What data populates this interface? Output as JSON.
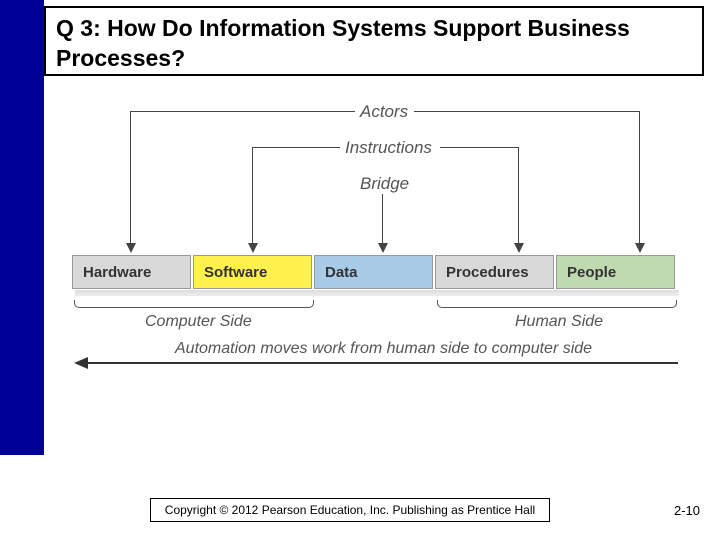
{
  "title": "Q 3: How Do Information Systems Support Business Processes?",
  "top_labels": {
    "actors": "Actors",
    "instructions": "Instructions",
    "bridge": "Bridge"
  },
  "components": [
    {
      "label": "Hardware",
      "bg": "#d9d9d9"
    },
    {
      "label": "Software",
      "bg": "#fff04d"
    },
    {
      "label": "Data",
      "bg": "#a8cce8"
    },
    {
      "label": "Procedures",
      "bg": "#d9d9d9"
    },
    {
      "label": "People",
      "bg": "#bfd9b0"
    }
  ],
  "sides": {
    "computer": "Computer Side",
    "human": "Human Side"
  },
  "automation_caption": "Automation moves work from human side to computer side",
  "copyright": "Copyright © 2012 Pearson Education, Inc. Publishing as Prentice Hall",
  "page_number": "2-10"
}
